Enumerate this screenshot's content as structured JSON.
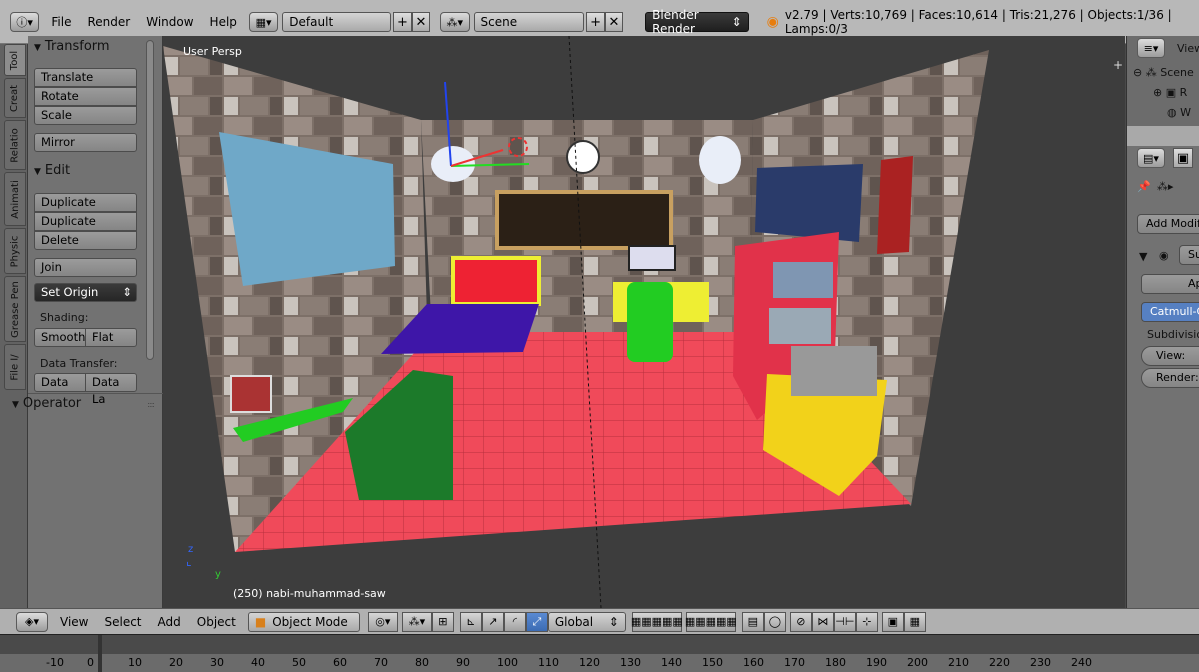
{
  "header": {
    "menu": [
      "File",
      "Render",
      "Window",
      "Help"
    ],
    "layout": "Default",
    "scene": "Scene",
    "engine": "Blender Render",
    "stats": "v2.79 | Verts:10,769 | Faces:10,614 | Tris:21,276 | Objects:1/36 | Lamps:0/3"
  },
  "tabs": [
    "Tool",
    "Creat",
    "Relatio",
    "Animati",
    "Physic",
    "Grease Pen",
    "File I/"
  ],
  "toolshelf": {
    "transform_title": "Transform",
    "translate": "Translate",
    "rotate": "Rotate",
    "scale": "Scale",
    "mirror": "Mirror",
    "edit_title": "Edit",
    "duplicate": "Duplicate",
    "duplicate_linked": "Duplicate Linked",
    "delete": "Delete",
    "join": "Join",
    "set_origin": "Set Origin",
    "shading_label": "Shading:",
    "smooth": "Smooth",
    "flat": "Flat",
    "data_transfer_label": "Data Transfer:",
    "data": "Data",
    "data_layout": "Data La",
    "operator_title": "Operator"
  },
  "viewport": {
    "view_label": "User Persp",
    "object_label": "(250) nabi-muhammad-saw"
  },
  "outliner": {
    "view": "View",
    "scene": "Scene",
    "r": "R",
    "w": "W"
  },
  "properties": {
    "add_modifier": "Add Modifi",
    "modifier_name": "Su",
    "apply": "Apply",
    "catmull": "Catmull-C",
    "subdivision": "Subdivisio",
    "view": "View:",
    "render": "Render:"
  },
  "bottombar": {
    "menu": [
      "View",
      "Select",
      "Add",
      "Object"
    ],
    "mode": "Object Mode",
    "orientation": "Global"
  },
  "timeline": {
    "ticks": [
      "-10",
      "0",
      "10",
      "20",
      "30",
      "40",
      "50",
      "60",
      "70",
      "80",
      "90",
      "100",
      "110",
      "120",
      "130",
      "140",
      "150",
      "160",
      "170",
      "180",
      "190",
      "200",
      "210",
      "220",
      "230",
      "240"
    ]
  }
}
